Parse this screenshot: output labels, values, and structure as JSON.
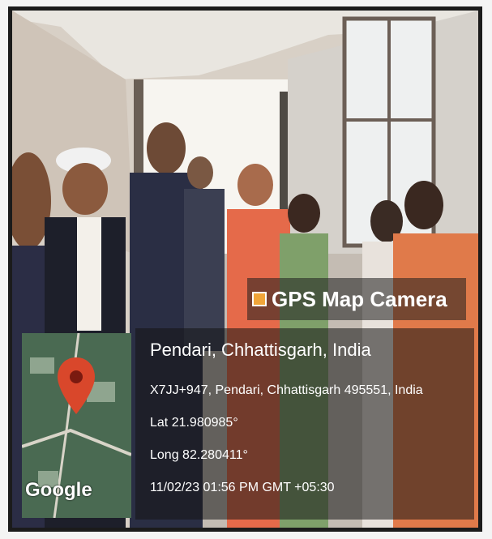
{
  "watermark": {
    "app_name": "GPS Map Camera",
    "place": "Pendari, Chhattisgarh, India",
    "address": "X7JJ+947, Pendari, Chhattisgarh 495551, India",
    "lat": "Lat 21.980985°",
    "long": "Long 82.280411°",
    "datetime": "11/02/23 01:56 PM GMT +05:30",
    "map_brand": "Google"
  },
  "colors": {
    "border": "#1b1b1b",
    "overlay": "rgba(20,20,20,0.55)",
    "pin": "#d9472b"
  }
}
